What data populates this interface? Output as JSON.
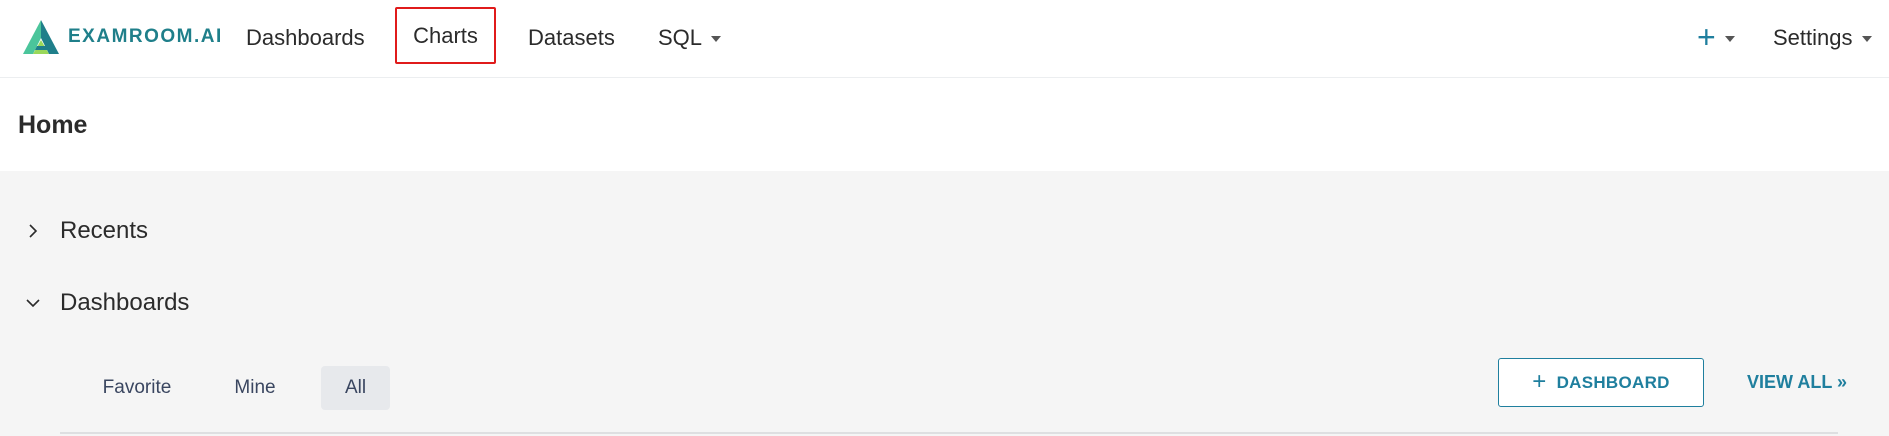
{
  "brand": {
    "name": "EXAMROOM.AI"
  },
  "nav": {
    "dashboards": "Dashboards",
    "charts": "Charts",
    "datasets": "Datasets",
    "sql": "SQL",
    "plus": "+",
    "settings": "Settings"
  },
  "page": {
    "title": "Home"
  },
  "sections": {
    "recents": "Recents",
    "dashboards": "Dashboards"
  },
  "tabs": [
    "Favorite",
    "Mine",
    "All"
  ],
  "active_tab": "All",
  "actions": {
    "add_dashboard": "DASHBOARD",
    "add_icon": "+",
    "view_all": "VIEW ALL »"
  },
  "colors": {
    "accent": "#1f7f9e",
    "brand_text": "#1f7f8a",
    "highlight_box": "#e01b1b",
    "content_bg": "#f5f5f5",
    "active_tab_bg": "#e7e9ec"
  },
  "icons": {
    "brand": "examroom-logo-icon",
    "recents_toggle": "chevron-right-icon",
    "dashboards_toggle": "chevron-down-icon",
    "dropdown": "caret-down-icon"
  }
}
